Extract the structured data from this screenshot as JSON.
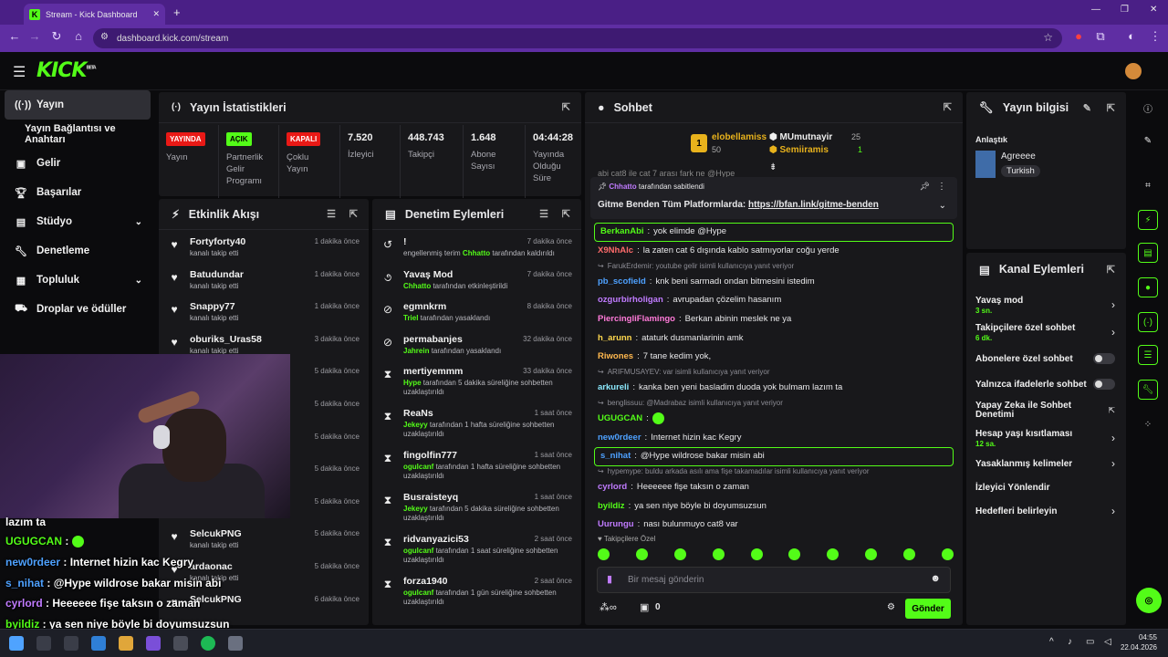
{
  "browser": {
    "tab_title": "Stream - Kick Dashboard",
    "url": "dashboard.kick.com/stream"
  },
  "app": {
    "logo": "KICK",
    "logo_sup": "BETA"
  },
  "sidebar": {
    "items": [
      {
        "label": "Yayın",
        "icon": "broadcast-icon",
        "active": true
      },
      {
        "label": "Yayın Bağlantısı ve Anahtarı",
        "icon": "",
        "sub": true
      },
      {
        "label": "Gelir",
        "icon": "revenue-icon"
      },
      {
        "label": "Başarılar",
        "icon": "trophy-icon"
      },
      {
        "label": "Stüdyo",
        "icon": "studio-icon",
        "chevron": true
      },
      {
        "label": "Denetleme",
        "icon": "wrench-icon"
      },
      {
        "label": "Topluluk",
        "icon": "community-icon",
        "chevron": true
      },
      {
        "label": "Droplar ve ödüller",
        "icon": "drops-icon"
      }
    ]
  },
  "stats": {
    "title": "Yayın İstatistikleri",
    "items": [
      {
        "badge": "YAYINDA",
        "badge_color": "#e91916",
        "label": "Yayın"
      },
      {
        "badge": "AÇIK",
        "badge_color": "#53fc18",
        "label": "Partnerlik Gelir Programı"
      },
      {
        "badge": "KAPALI",
        "badge_color": "#e91916",
        "label": "Çoklu Yayın"
      },
      {
        "value": "7.520",
        "label": "İzleyici"
      },
      {
        "value": "448.743",
        "label": "Takipçi"
      },
      {
        "value": "1.648",
        "label": "Abone Sayısı"
      },
      {
        "value": "04:44:28",
        "label": "Yayında Olduğu Süre"
      }
    ]
  },
  "activity": {
    "title": "Etkinlik Akışı",
    "items": [
      {
        "name": "Fortyforty40",
        "sub": "kanalı takip etti",
        "time": "1 dakika önce"
      },
      {
        "name": "Batudundar",
        "sub": "kanalı takip etti",
        "time": "1 dakika önce"
      },
      {
        "name": "Snappy77",
        "sub": "kanalı takip etti",
        "time": "1 dakika önce"
      },
      {
        "name": "oburiks_Uras58",
        "sub": "kanalı takip etti",
        "time": "3 dakika önce"
      },
      {
        "name": "",
        "sub": "",
        "time": "5 dakika önce"
      },
      {
        "name": "en",
        "sub": "",
        "time": "5 dakika önce"
      },
      {
        "name": "",
        "sub": "",
        "time": "5 dakika önce"
      },
      {
        "name": "",
        "sub": "",
        "time": "5 dakika önce"
      },
      {
        "name": "",
        "sub": "",
        "time": "5 dakika önce"
      },
      {
        "name": "SelcukPNG",
        "sub": "kanalı takip etti",
        "time": "5 dakika önce"
      },
      {
        "name": "ardaonac",
        "sub": "kanalı takip etti",
        "time": "5 dakika önce"
      },
      {
        "name": "SelcukPNG",
        "sub": "",
        "time": "6 dakika önce"
      }
    ]
  },
  "moderation": {
    "title": "Denetim Eylemleri",
    "items": [
      {
        "icon": "undo-icon",
        "name": "!",
        "pre": "engellenmiş terim ",
        "user": "Chhatto",
        "post": " tarafından kaldırıldı",
        "time": "7 dakika önce"
      },
      {
        "icon": "snail-icon",
        "name": "Yavaş Mod",
        "pre": "",
        "user": "Chhatto",
        "post": " tarafından etkinleştirildi",
        "time": "7 dakika önce"
      },
      {
        "icon": "ban-icon",
        "name": "egmnkrm",
        "pre": "",
        "user": "Triel",
        "post": " tarafından yasaklandı",
        "time": "8 dakika önce"
      },
      {
        "icon": "ban-icon",
        "name": "permabanjes",
        "pre": "",
        "user": "Jahrein",
        "post": " tarafından yasaklandı",
        "time": "32 dakika önce"
      },
      {
        "icon": "hourglass-icon",
        "name": "mertiyemmm",
        "pre": "",
        "user": "Hype",
        "post": " tarafından 5 dakika süreliğine sohbetten uzaklaştırıldı",
        "time": "33 dakika önce"
      },
      {
        "icon": "hourglass-icon",
        "name": "ReaNs",
        "pre": "",
        "user": "Jekeyy",
        "post": " tarafından 1 hafta süreliğine sohbetten uzaklaştırıldı",
        "time": "1 saat önce"
      },
      {
        "icon": "hourglass-icon",
        "name": "fingolfin777",
        "pre": "",
        "user": "ogulcanf",
        "post": " tarafından 1 hafta süreliğine sohbetten uzaklaştırıldı",
        "time": "1 saat önce"
      },
      {
        "icon": "hourglass-icon",
        "name": "Busraisteyq",
        "pre": "",
        "user": "Jekeyy",
        "post": " tarafından 5 dakika süreliğine sohbetten uzaklaştırıldı",
        "time": "1 saat önce"
      },
      {
        "icon": "hourglass-icon",
        "name": "ridvanyazici53",
        "pre": "",
        "user": "ogulcanf",
        "post": " tarafından 1 saat süreliğine sohbetten uzaklaştırıldı",
        "time": "2 saat önce"
      },
      {
        "icon": "hourglass-icon",
        "name": "forza1940",
        "pre": "",
        "user": "ogulcanf",
        "post": " tarafından 1 gün süreliğine sohbetten uzaklaştırıldı",
        "time": "2 saat önce"
      }
    ]
  },
  "chat": {
    "title": "Sohbet",
    "top_gifters": [
      {
        "rank": "1",
        "name": "elobellamiss",
        "value": "50"
      },
      {
        "name": "MUmutnayir",
        "value": "25"
      },
      {
        "name": "Semiiramis",
        "value": "1"
      }
    ],
    "partial_line": "abi cat8 ile cat 7 arası fark ne @Hype",
    "pinned": {
      "by": "Chhatto",
      "by_suffix": "tarafından sabitlendi",
      "text": "Gitme Benden Tüm Platformlarda: ",
      "link": "https://bfan.link/gitme-benden"
    },
    "messages": [
      {
        "user": "BerkanAbi",
        "color": "#53fc18",
        "text": "yok elimde @Hype",
        "hl": true
      },
      {
        "user": "X9NhAlc",
        "color": "#ff6b6b",
        "text": "la zaten cat 6 dışında kablo satmıyorlar coğu yerde"
      },
      {
        "reply": "FarukErdemir: youtube gelir isimli kullanıcıya yanıt veriyor"
      },
      {
        "user": "pb_scofield",
        "color": "#4ea1ff",
        "text": "knk beni sarmadı ondan bitmesini istedim"
      },
      {
        "user": "ozgurbirholigan",
        "color": "#c07bff",
        "text": "avrupadan çözelim hasanım"
      },
      {
        "user": "PiercingliFlamingo",
        "color": "#ff7ad9",
        "text": "Berkan abinin meslek ne ya"
      },
      {
        "user": "h_arunn",
        "color": "#ffd84e",
        "text": "ataturk dusmanlarinin amk"
      },
      {
        "user": "Riwones",
        "color": "#ffb84e",
        "text": "7 tane kedim yok,"
      },
      {
        "reply": "ARIFMUSAYEV: var isimli kullanıcıya yanıt veriyor"
      },
      {
        "user": "arkureli",
        "color": "#8be9fd",
        "text": "kanka ben yeni basladim duoda yok bulmam lazım ta"
      },
      {
        "reply": "benglissuu: @Madrabaz isimli kullanıcıya yanıt veriyor"
      },
      {
        "user": "UGUGCAN",
        "color": "#53fc18",
        "text": "",
        "emote": true
      },
      {
        "user": "new0rdeer",
        "color": "#4ea1ff",
        "text": "Internet hizin kac Kegry"
      },
      {
        "user": "s_nihat",
        "color": "#4ea1ff",
        "text": "@Hype wildrose bakar misin abi",
        "hl": true
      },
      {
        "reply": "hypemype: buldu arkada asılı ama fişe takamadılar isimli kullanıcıya yanıt veriyor"
      },
      {
        "user": "cyrlord",
        "color": "#c07bff",
        "text": "Heeeeee fişe taksın o zaman"
      },
      {
        "user": "byildiz",
        "color": "#53fc18",
        "text": "ya sen niye böyle bi doyumsuzsun"
      },
      {
        "user": "Uurungu",
        "color": "#c07bff",
        "text": "nası bulunmuyo cat8 var"
      }
    ],
    "emote_label": "Takipçilere Özel",
    "input_placeholder": "Bir mesaj gönderin",
    "points": "0",
    "send": "Gönder"
  },
  "streaminfo": {
    "title": "Yayın bilgisi",
    "category_label": "Anlaştık",
    "category": "Agreeee",
    "tag": "Turkish"
  },
  "channel_actions": {
    "title": "Kanal Eylemleri",
    "items": [
      {
        "label": "Yavaş mod",
        "sub": "3 sn.",
        "ctl": "chevron"
      },
      {
        "label": "Takipçilere özel sohbet",
        "sub": "6 dk.",
        "ctl": "chevron"
      },
      {
        "label": "Abonelere özel sohbet",
        "ctl": "toggle"
      },
      {
        "label": "Yalnızca ifadelerle sohbet",
        "ctl": "toggle"
      },
      {
        "label": "Yapay Zeka ile Sohbet Denetimi",
        "ctl": "ext"
      },
      {
        "label": "Hesap yaşı kısıtlaması",
        "sub": "12 sa.",
        "ctl": "chevron"
      },
      {
        "label": "Yasaklanmış kelimeler",
        "ctl": "chevron"
      },
      {
        "label": "İzleyici Yönlendir",
        "ctl": ""
      },
      {
        "label": "Hedefleri belirleyin",
        "ctl": "chevron"
      }
    ]
  },
  "overlay_chat": [
    {
      "user": "",
      "text": "lazım ta"
    },
    {
      "user": "UGUGCAN",
      "color": "#53fc18",
      "text": ""
    },
    {
      "user": "new0rdeer",
      "color": "#4ea1ff",
      "text": "Internet hizin kac Kegry"
    },
    {
      "user": "s_nihat",
      "color": "#4ea1ff",
      "text": "@Hype wildrose bakar misin abi"
    },
    {
      "user": "cyrlord",
      "color": "#c07bff",
      "text": "Heeeeee fişe taksın o zaman"
    },
    {
      "user": "byildiz",
      "color": "#53fc18",
      "text": "ya sen niye böyle bi doyumsuzsun"
    },
    {
      "user": "Uurungu",
      "color": "#c07bff",
      "text": "nası bulunmuyo cat8 var"
    }
  ],
  "taskbar": {
    "time": "04:55",
    "date": "22.04.2026"
  }
}
